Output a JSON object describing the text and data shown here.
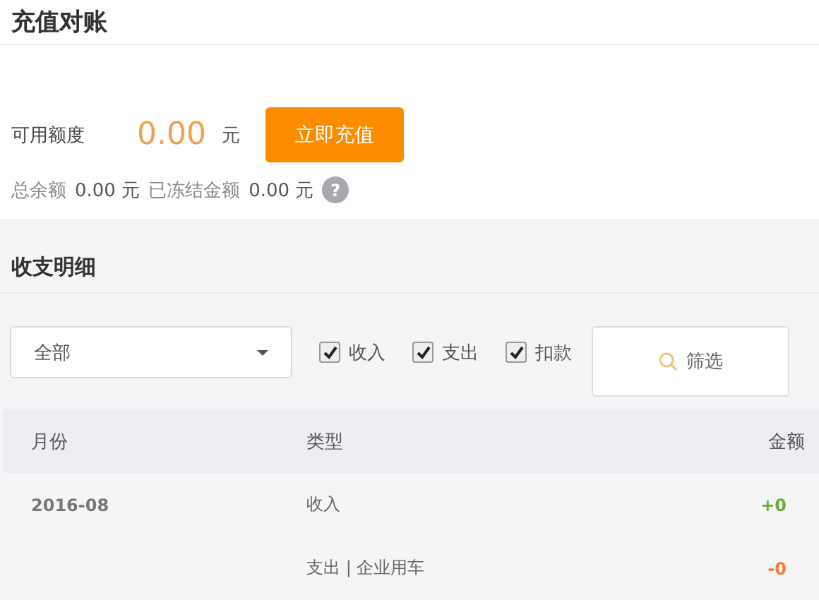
{
  "title": "充值对账",
  "balance": {
    "label": "可用额度",
    "amount": "0.00",
    "unit": "元",
    "button": "立即充值"
  },
  "summary": [
    {
      "label": "总余额",
      "value": "0.00 元"
    },
    {
      "label": "已冻结金额",
      "value": "0.00 元"
    }
  ],
  "help_icon": "?",
  "section_title": "收支明细",
  "filter": {
    "select": "全部",
    "checks": [
      {
        "label": "收入",
        "checked": true
      },
      {
        "label": "支出",
        "checked": true
      },
      {
        "label": "扣款",
        "checked": true
      }
    ],
    "button": "筛选"
  },
  "table": {
    "columns": [
      "月份",
      "类型",
      "金额"
    ],
    "rows": [
      {
        "month": "2016-08",
        "type": "收入",
        "amount": "+0",
        "color": "#6aaa3c"
      },
      {
        "month": "",
        "type": "支出 | 企业用车",
        "amount": "-0",
        "color": "#ee7d3c"
      }
    ]
  }
}
